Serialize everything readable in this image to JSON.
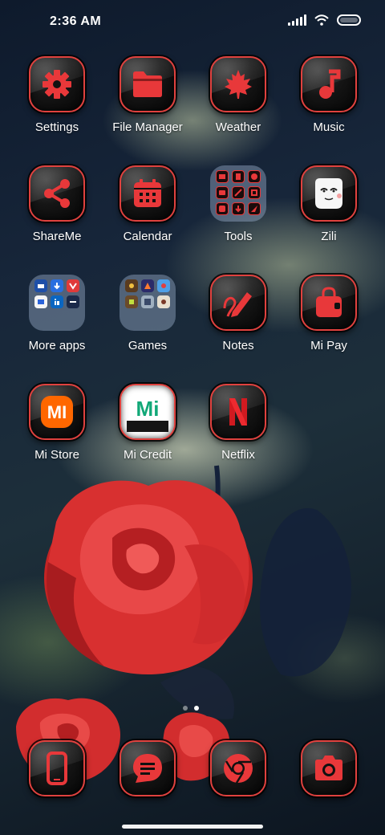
{
  "status_bar": {
    "time": "2:36 AM",
    "icons": [
      "signal-icon",
      "wifi-icon",
      "battery-icon"
    ]
  },
  "home_screen": {
    "apps": [
      {
        "label": "Settings",
        "icon": "gear-icon"
      },
      {
        "label": "File Manager",
        "icon": "folder-icon"
      },
      {
        "label": "Weather",
        "icon": "maple-leaf-icon"
      },
      {
        "label": "Music",
        "icon": "music-note-icon"
      },
      {
        "label": "ShareMe",
        "icon": "share-icon"
      },
      {
        "label": "Calendar",
        "icon": "calendar-icon"
      },
      {
        "label": "Tools",
        "icon": "tools-folder-icon"
      },
      {
        "label": "Zili",
        "icon": "zili-face-icon"
      },
      {
        "label": "More apps",
        "icon": "apps-folder-icon"
      },
      {
        "label": "Games",
        "icon": "games-folder-icon"
      },
      {
        "label": "Notes",
        "icon": "pencil-icon"
      },
      {
        "label": "Mi Pay",
        "icon": "shopping-bag-icon"
      },
      {
        "label": "Mi Store",
        "icon": "mi-logo-icon",
        "logo_text": "MI"
      },
      {
        "label": "Mi Credit",
        "icon": "mi-credit-logo-icon",
        "logo_text": "Mi"
      },
      {
        "label": "Netflix",
        "icon": "netflix-logo-icon",
        "logo_text": "N"
      }
    ]
  },
  "page_indicator": {
    "pages": 2,
    "current": 2
  },
  "dock": {
    "apps": [
      {
        "name": "Phone",
        "icon": "phone-icon"
      },
      {
        "name": "Messages",
        "icon": "message-icon"
      },
      {
        "name": "Chrome",
        "icon": "chrome-icon"
      },
      {
        "name": "Camera",
        "icon": "camera-icon"
      }
    ]
  },
  "colors": {
    "accent_red": "#e8383a",
    "icon_background": "#0b0b0b",
    "folder_background": "#8ea2bf",
    "mi_orange": "#ff6700"
  }
}
